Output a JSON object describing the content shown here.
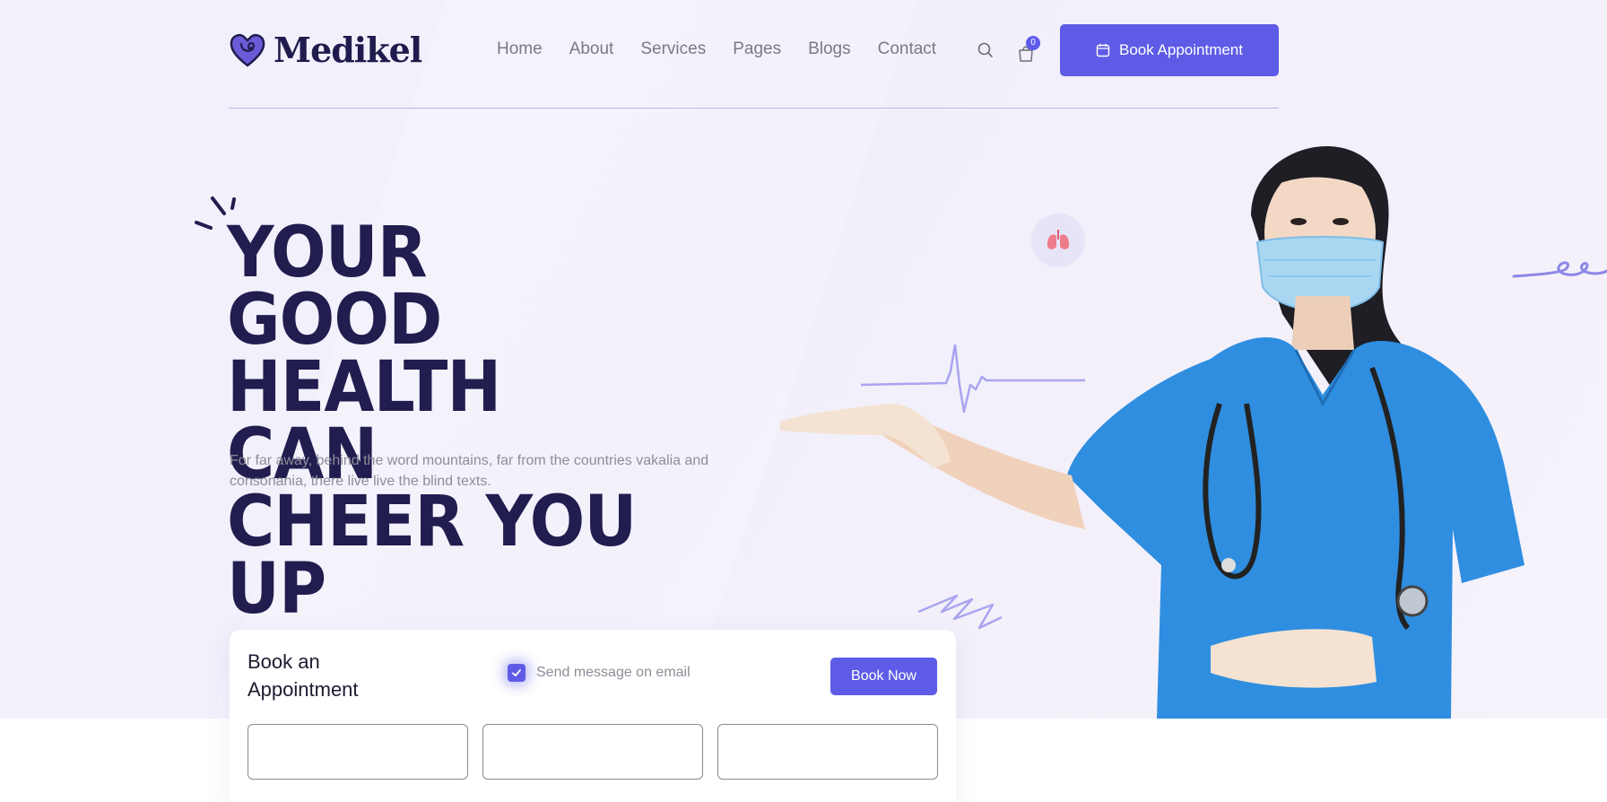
{
  "brand": {
    "name": "Medikel",
    "accent": "#5e5ce6",
    "dark": "#211d4f"
  },
  "nav": {
    "items": [
      "Home",
      "About",
      "Services",
      "Pages",
      "Blogs",
      "Contact"
    ],
    "cart_count": "0",
    "book_label": "Book Appointment"
  },
  "hero": {
    "headline_lines": [
      "YOUR GOOD",
      "HEALTH CAN",
      "CHEER YOU UP"
    ],
    "subtext": "For far away, behind the word mountains, far from the countries vakalia and consonania, there live live the blind texts."
  },
  "appointment": {
    "title": "Book an Appointment",
    "checkbox_label": "Send message on email",
    "checkbox_checked": true,
    "submit_label": "Book Now",
    "fields": [
      {
        "value": ""
      },
      {
        "value": ""
      },
      {
        "value": ""
      }
    ]
  },
  "icons": [
    "heart-logo-icon",
    "search-icon",
    "cart-icon",
    "calendar-icon",
    "lungs-icon",
    "check-icon"
  ]
}
